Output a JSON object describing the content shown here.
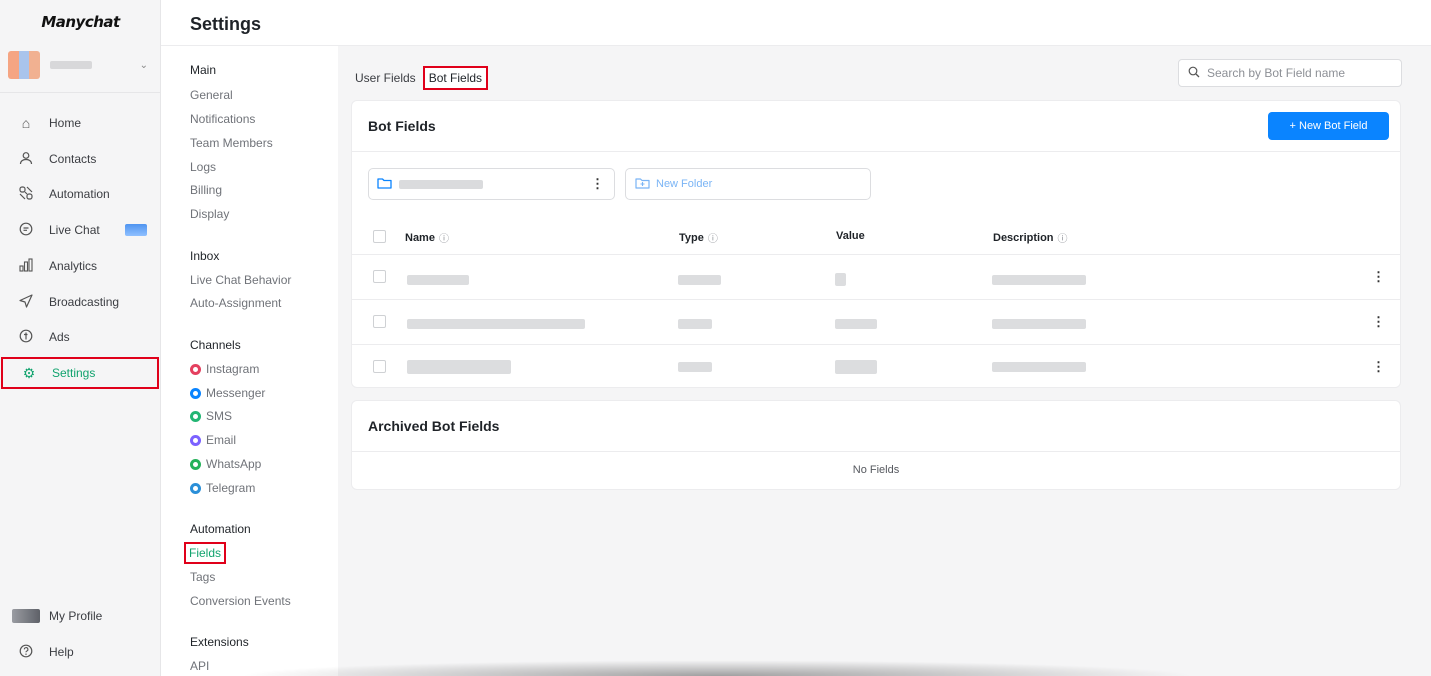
{
  "brand": {
    "logo": "Manychat",
    "accent": "#0a84ff",
    "active_green": "#11a36e",
    "highlight_red": "#e0001a"
  },
  "sidebar": {
    "items": [
      {
        "label": "Home",
        "icon": "home-icon"
      },
      {
        "label": "Contacts",
        "icon": "person-icon"
      },
      {
        "label": "Automation",
        "icon": "automation-icon"
      },
      {
        "label": "Live Chat",
        "icon": "chat-icon"
      },
      {
        "label": "Analytics",
        "icon": "bar-chart-icon"
      },
      {
        "label": "Broadcasting",
        "icon": "send-icon"
      },
      {
        "label": "Ads",
        "icon": "ads-icon"
      },
      {
        "label": "Settings",
        "icon": "gear-icon"
      }
    ],
    "footer": [
      {
        "label": "My Profile"
      },
      {
        "label": "Help",
        "icon": "help-icon"
      }
    ]
  },
  "header": {
    "title": "Settings"
  },
  "settings_menu": {
    "main": {
      "title": "Main",
      "items": [
        "General",
        "Notifications",
        "Team Members",
        "Logs",
        "Billing",
        "Display"
      ]
    },
    "inbox": {
      "title": "Inbox",
      "items": [
        "Live Chat Behavior",
        "Auto-Assignment"
      ]
    },
    "channels": {
      "title": "Channels",
      "items": [
        {
          "label": "Instagram",
          "color": "#e4405f"
        },
        {
          "label": "Messenger",
          "color": "#0a84ff"
        },
        {
          "label": "SMS",
          "color": "#22b573"
        },
        {
          "label": "Email",
          "color": "#7b61ff"
        },
        {
          "label": "WhatsApp",
          "color": "#25b15a"
        },
        {
          "label": "Telegram",
          "color": "#2a8fd8"
        }
      ]
    },
    "automation": {
      "title": "Automation",
      "items": [
        "Fields",
        "Tags",
        "Conversion Events"
      ]
    },
    "extensions": {
      "title": "Extensions",
      "items": [
        "API"
      ]
    }
  },
  "tabs": [
    "User Fields",
    "Bot Fields"
  ],
  "search": {
    "placeholder": "Search by Bot Field name"
  },
  "bot_fields": {
    "title": "Bot Fields",
    "new_button": "+ New Bot Field",
    "new_folder": "New Folder",
    "columns": [
      "Name",
      "Type",
      "Value",
      "Description"
    ]
  },
  "archived": {
    "title": "Archived Bot Fields",
    "empty": "No Fields"
  }
}
